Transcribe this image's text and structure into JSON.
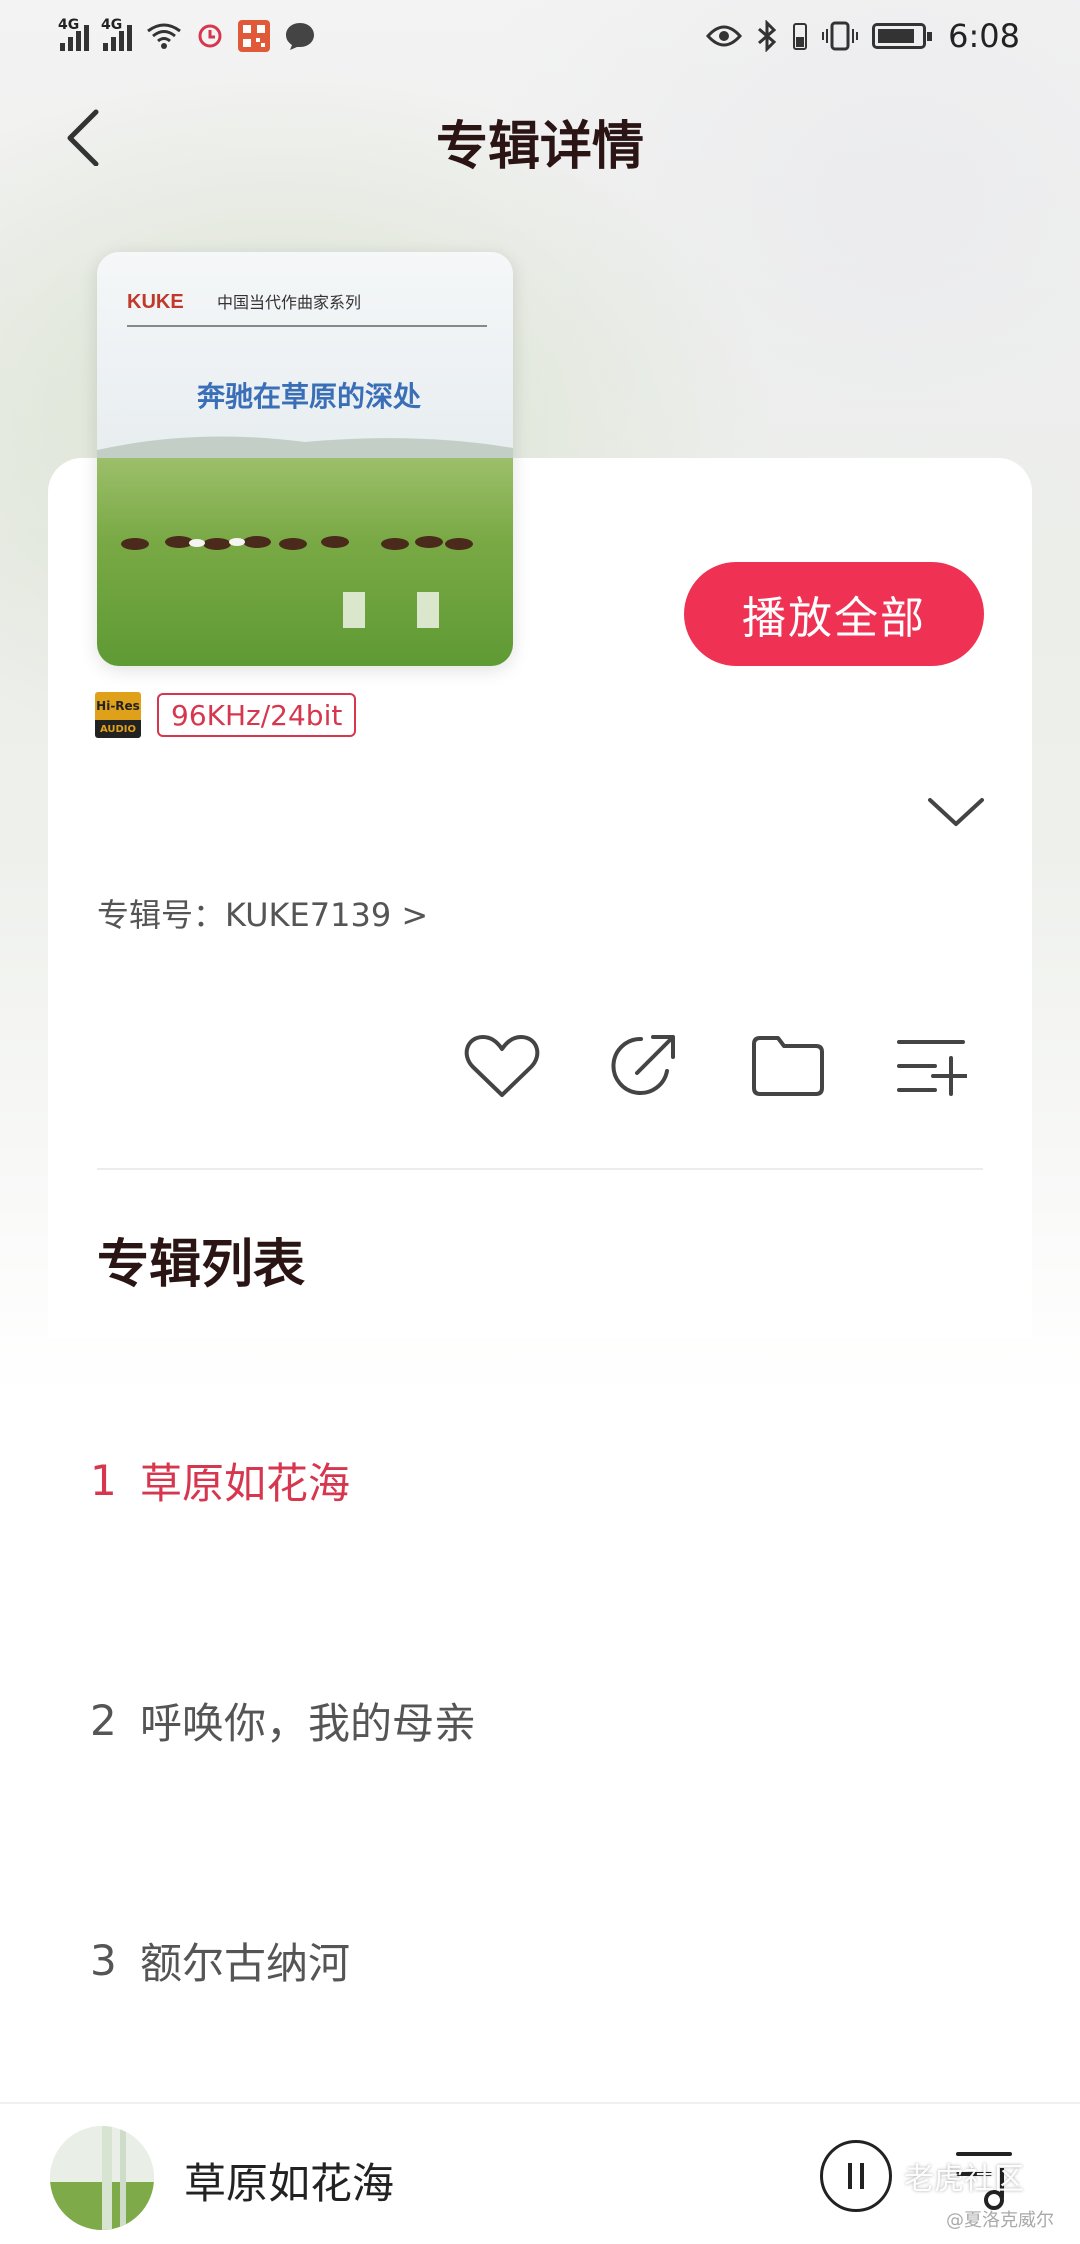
{
  "status_bar": {
    "net1": "4G",
    "net2": "4G",
    "time": "6:08"
  },
  "header": {
    "title": "专辑详情"
  },
  "album": {
    "cover_brand": "KUKE",
    "cover_series": "中国当代作曲家系列",
    "cover_title": "奔驰在草原的深处",
    "play_all_label": "播放全部",
    "hires_top": "Hi-Res",
    "hires_bottom": "AUDIO",
    "quality": "96KHz/24bit",
    "album_number": "专辑号：KUKE7139 >"
  },
  "actions": {
    "icons": [
      "heart-icon",
      "share-icon",
      "folder-icon",
      "add-to-playlist-icon"
    ]
  },
  "tracklist": {
    "section_title": "专辑列表",
    "tracks": [
      {
        "number": "1",
        "title": "草原如花海",
        "active": true
      },
      {
        "number": "2",
        "title": "呼唤你，我的母亲",
        "active": false
      },
      {
        "number": "3",
        "title": "额尔古纳河",
        "active": false
      }
    ]
  },
  "mini_player": {
    "title": "草原如花海"
  },
  "watermark": {
    "text": "老虎社区",
    "sub": "@夏洛克威尔"
  },
  "colors": {
    "accent": "#ef3254",
    "accent_text": "#d6374f",
    "title": "#2a1414"
  }
}
